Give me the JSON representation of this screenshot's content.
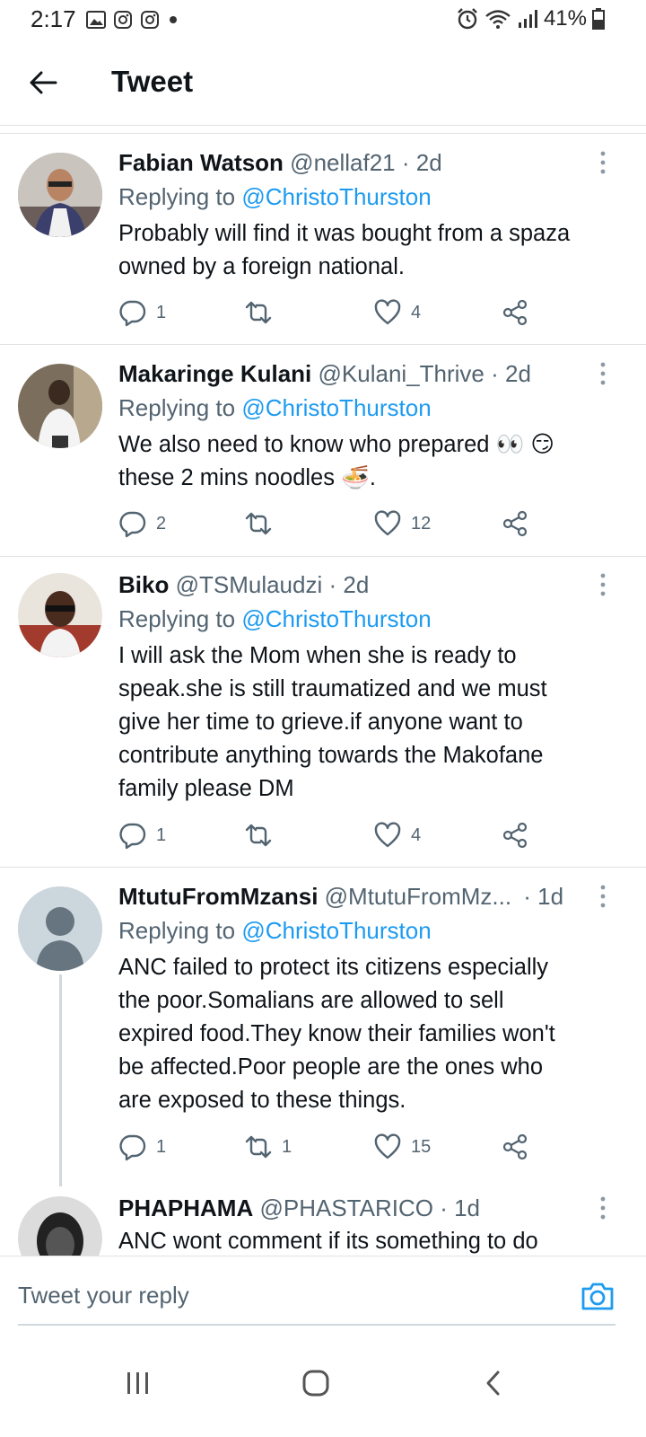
{
  "status_bar": {
    "time": "2:17",
    "battery": "41%",
    "left_icons": [
      "gallery-icon",
      "instagram-icon",
      "instagram-icon",
      "dot-icon"
    ],
    "right_icons": [
      "alarm-icon",
      "wifi-icon",
      "signal-icon",
      "battery-icon"
    ]
  },
  "header": {
    "title": "Tweet"
  },
  "tweets": [
    {
      "name": "Fabian Watson",
      "handle": "@nellaf21",
      "time": "· 2d",
      "replying_prefix": "Replying to ",
      "replying_to": "@ChristoThurston",
      "text_lines": [
        "Probably will find it was bought from a spaza",
        "owned by a foreign national."
      ],
      "replies": "1",
      "retweets": "",
      "likes": "4"
    },
    {
      "name": "Makaringe Kulani",
      "handle": "@Kulani_Thrive",
      "time": "· 2d",
      "replying_prefix": "Replying to ",
      "replying_to": "@ChristoThurston",
      "text_lines": [
        "We also need to know who prepared 👀 😏",
        "these 2 mins noodles 🍜."
      ],
      "replies": "2",
      "retweets": "",
      "likes": "12"
    },
    {
      "name": "Biko",
      "handle": "@TSMulaudzi",
      "time": "· 2d",
      "replying_prefix": "Replying to ",
      "replying_to": "@ChristoThurston",
      "text_lines": [
        "I will ask the Mom when she is ready to",
        "speak.she is still traumatized and we must",
        "give her time to grieve.if anyone want to",
        "contribute anything towards the Makofane",
        "family please DM"
      ],
      "replies": "1",
      "retweets": "",
      "likes": "4"
    },
    {
      "name": "MtutuFromMzansi",
      "handle": "@MtutuFromMz...",
      "time": "· 1d",
      "replying_prefix": "Replying to ",
      "replying_to": "@ChristoThurston",
      "text_lines": [
        "ANC failed to protect its citizens especially",
        "the poor.Somalians are allowed to sell",
        "expired food.They know their families won't",
        "be affected.Poor people are the ones who",
        "are exposed to these things."
      ],
      "replies": "1",
      "retweets": "1",
      "likes": "15"
    },
    {
      "name": "PHAPHAMA",
      "handle": "@PHASTARICO",
      "time": "· 1d",
      "text_lines": [
        "ANC wont comment if its something to do"
      ]
    }
  ],
  "reply_box": {
    "placeholder": "Tweet your reply"
  },
  "colors": {
    "accent": "#1d9bf0",
    "secondary_text": "#536471",
    "primary_text": "#0f1419"
  }
}
